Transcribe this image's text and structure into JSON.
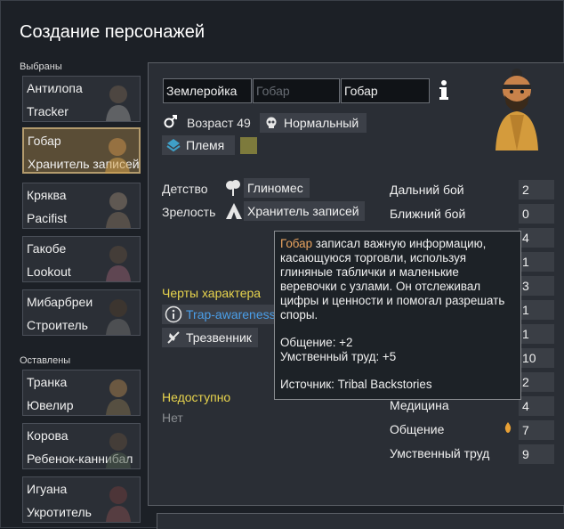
{
  "title": "Создание персонажей",
  "sections": {
    "chosen": "Выбраны",
    "left": "Оставлены"
  },
  "chosen_pawns": [
    {
      "name": "Антилопа",
      "role": "Tracker"
    },
    {
      "name": "Гобар",
      "role": "Хранитель записей"
    },
    {
      "name": "Кряква",
      "role": "Pacifist"
    },
    {
      "name": "Гакобе",
      "role": "Lookout"
    },
    {
      "name": "Мибарбреи",
      "role": "Строитель"
    }
  ],
  "left_pawns": [
    {
      "name": "Транка",
      "role": "Ювелир"
    },
    {
      "name": "Корова",
      "role": "Ребенок-каннибал"
    },
    {
      "name": "Игуана",
      "role": "Укротитель"
    }
  ],
  "name_fields": {
    "first": "Землеройка",
    "nick_placeholder": "Гобар",
    "last": "Гобар"
  },
  "age": "Возраст 49",
  "health": "Нормальный",
  "faction": "Племя",
  "faction_color": "#7d7a3c",
  "backstory": {
    "childhood_label": "Детство",
    "childhood": "Глиномес",
    "adulthood_label": "Зрелость",
    "adulthood": "Хранитель записей"
  },
  "traits": {
    "header": "Черты характера",
    "items": [
      "Trap-awareness",
      "Трезвенник"
    ]
  },
  "incapable": {
    "header": "Недоступно",
    "value": "Нет"
  },
  "skills": [
    {
      "name": "Дальний бой",
      "value": "2"
    },
    {
      "name": "Ближний бой",
      "value": "0"
    },
    {
      "name": "",
      "value": "4"
    },
    {
      "name": "",
      "value": "1"
    },
    {
      "name": "",
      "value": "3"
    },
    {
      "name": "",
      "value": "1"
    },
    {
      "name": "",
      "value": "1"
    },
    {
      "name": "",
      "value": "10"
    },
    {
      "name": "",
      "value": "2"
    },
    {
      "name": "Медицина",
      "value": "4"
    },
    {
      "name": "Общение",
      "value": "7"
    },
    {
      "name": "Умственный труд",
      "value": "9"
    }
  ],
  "tooltip": {
    "name": "Гобар",
    "text": " записал важную информацию, касающуюся торговли, используя глиняные таблички и маленькие веревочки с узлами. Он отслеживал цифры и ценности и помогал разрешать споры.",
    "bonus1": "Общение: +2",
    "bonus2": "Умственный труд: +5",
    "source": "Источник: Tribal Backstories"
  },
  "icons": {
    "info": "info-icon",
    "gender": "male-icon",
    "health": "skull-icon",
    "faction": "faction-icon",
    "childhood": "tree-icon",
    "adulthood": "tent-icon",
    "trait1": "info-circle-icon",
    "trait2": "no-drink-icon",
    "passion": "flame-icon"
  },
  "colors": {
    "accent_yellow": "#e8d44d",
    "tooltip_name": "#e8a35f",
    "link_blue": "#4a9ee8"
  }
}
